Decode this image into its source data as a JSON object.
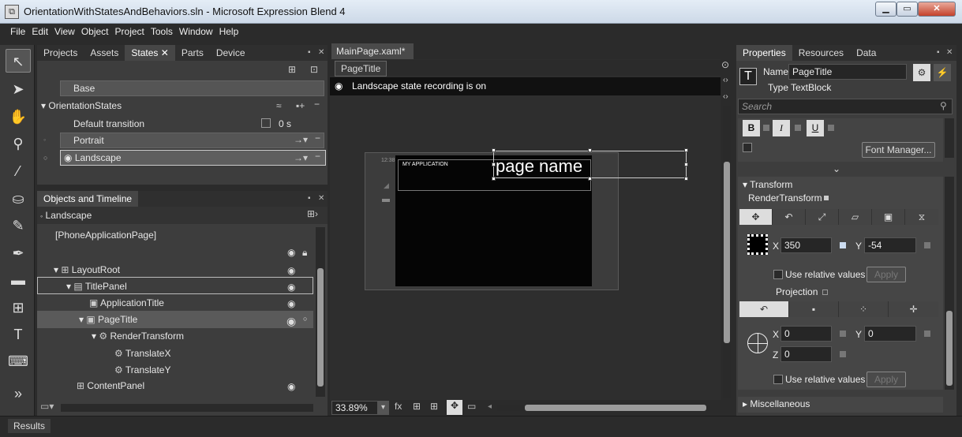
{
  "window": {
    "title": "OrientationWithStatesAndBehaviors.sln - Microsoft Expression Blend 4"
  },
  "menu": [
    "File",
    "Edit",
    "View",
    "Object",
    "Project",
    "Tools",
    "Window",
    "Help"
  ],
  "left_tabs": [
    "Projects",
    "Assets",
    "States",
    "Parts",
    "Device"
  ],
  "states": {
    "base": "Base",
    "group": "OrientationStates",
    "default_transition": "Default transition",
    "default_time": "0 s",
    "portrait": "Portrait",
    "landscape": "Landscape"
  },
  "objects_timeline": {
    "title": "Objects and Timeline",
    "current_state": "Landscape",
    "tree": [
      {
        "label": "[PhoneApplicationPage]",
        "indent": 0
      },
      {
        "label": "LayoutRoot",
        "indent": 1
      },
      {
        "label": "TitlePanel",
        "indent": 2
      },
      {
        "label": "ApplicationTitle",
        "indent": 3
      },
      {
        "label": "PageTitle",
        "indent": 3
      },
      {
        "label": "RenderTransform",
        "indent": 4
      },
      {
        "label": "TranslateX",
        "indent": 5
      },
      {
        "label": "TranslateY",
        "indent": 5
      },
      {
        "label": "ContentPanel",
        "indent": 2
      }
    ]
  },
  "document": {
    "tab": "MainPage.xaml*",
    "breadcrumb": "PageTitle",
    "recording": "Landscape state recording is on",
    "phone_time": "12:38",
    "app_title": "MY APPLICATION",
    "page_title": "page name",
    "zoom": "33.89%"
  },
  "right_tabs": [
    "Properties",
    "Resources",
    "Data"
  ],
  "properties": {
    "name_label": "Name",
    "name_value": "PageTitle",
    "type_label": "Type",
    "type_value": "TextBlock",
    "search_placeholder": "Search",
    "font_manager": "Font Manager...",
    "bold": "B",
    "italic": "I",
    "underline": "U",
    "transform": "Transform",
    "render_transform": "RenderTransform",
    "x_label": "X",
    "x_value": "350",
    "y_label": "Y",
    "y_value": "-54",
    "use_relative": "Use relative values",
    "apply": "Apply",
    "projection": "Projection",
    "px": "0",
    "py": "0",
    "pz_label": "Z",
    "pz": "0",
    "misc": "Miscellaneous"
  },
  "status": {
    "results": "Results"
  }
}
